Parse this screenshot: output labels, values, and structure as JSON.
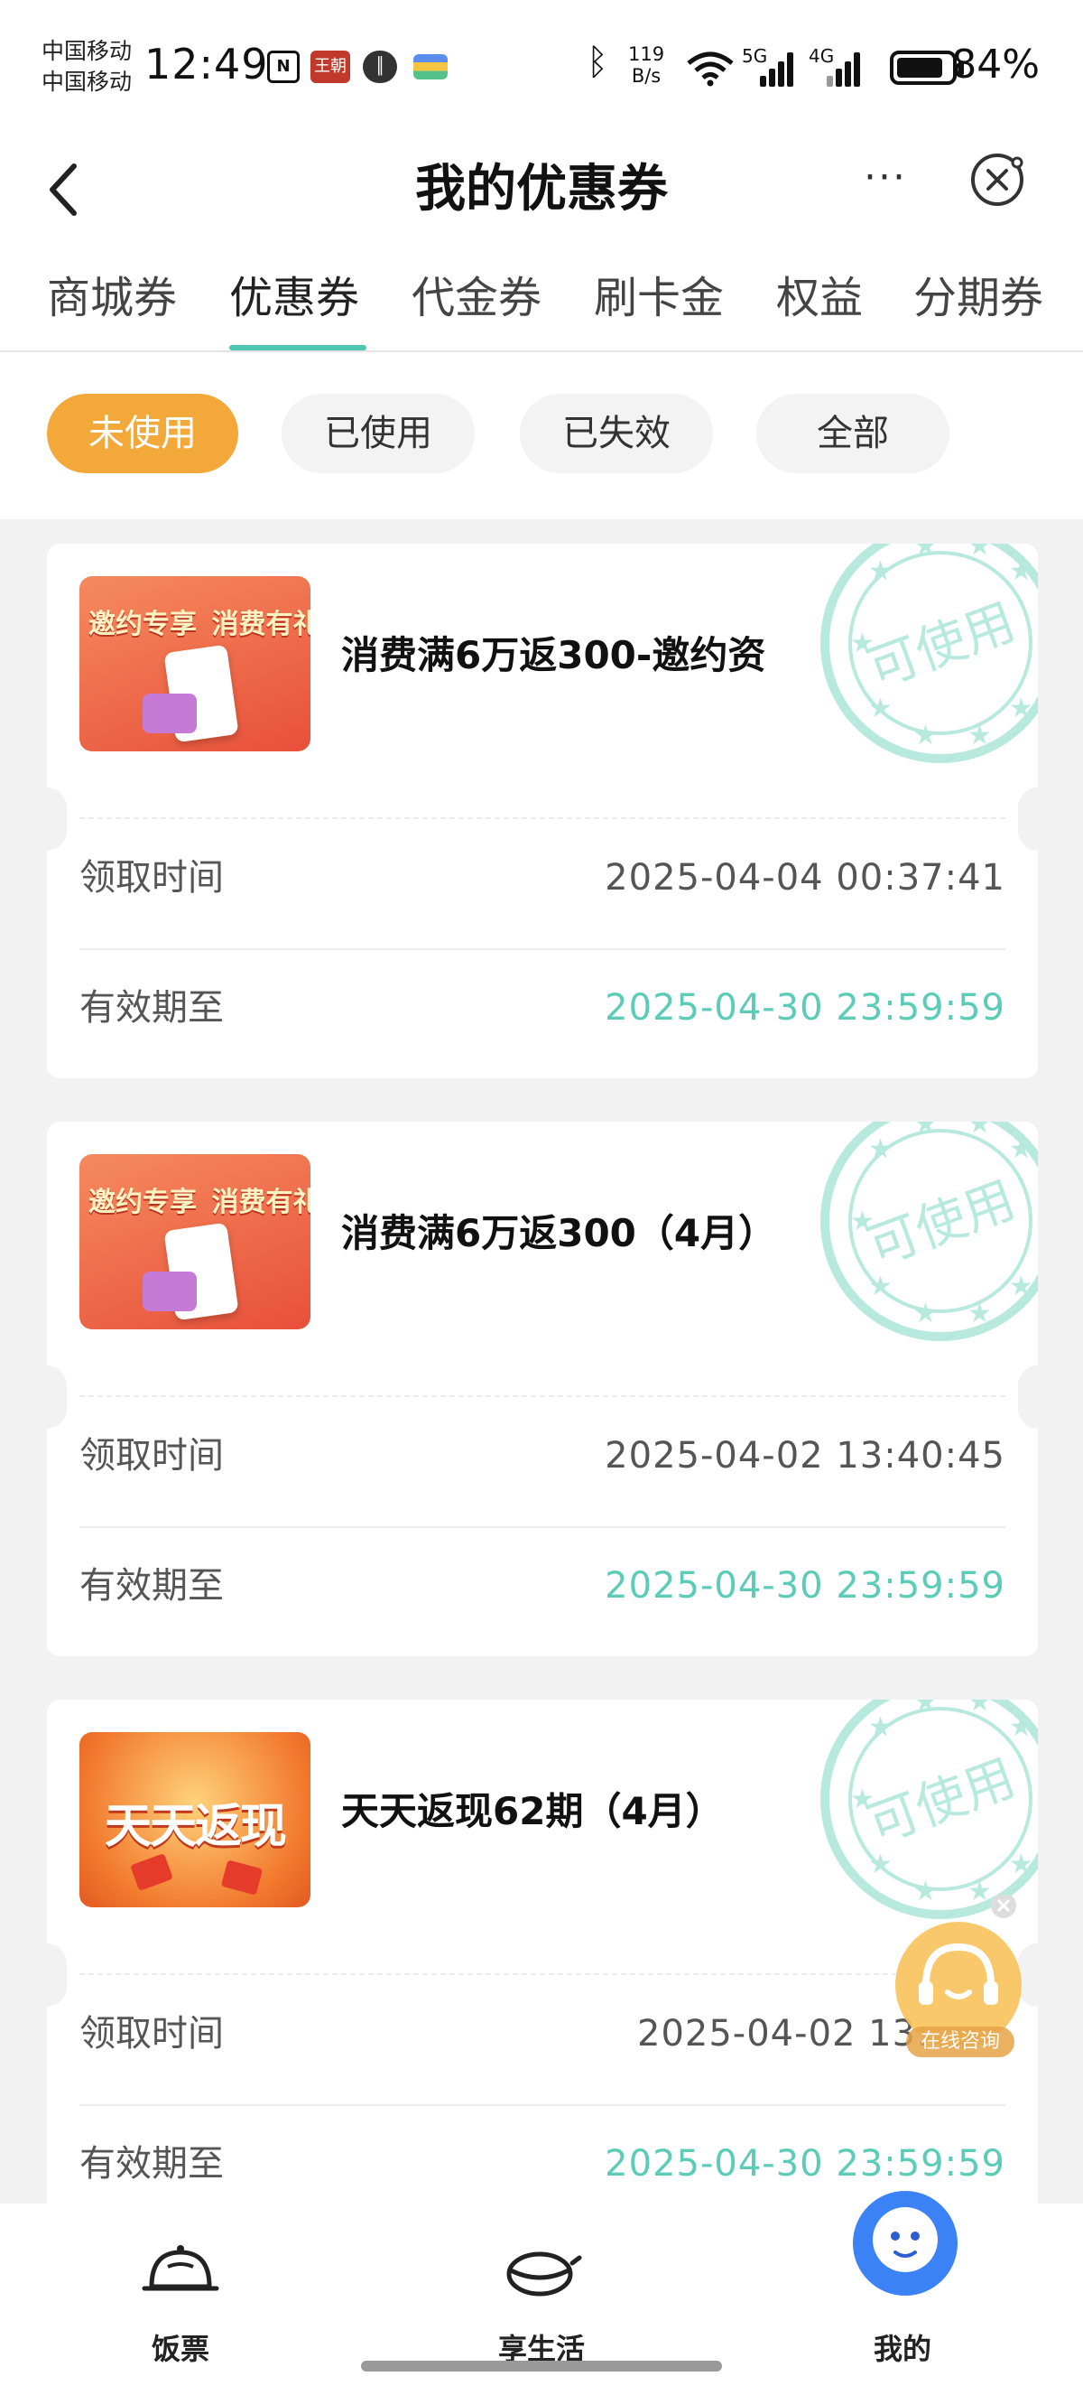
{
  "status_bar": {
    "carrier_1": "中国移动",
    "carrier_2": "中国移动",
    "time": "12:49",
    "app_badge": "王朝",
    "net_speed_top": "119",
    "net_speed_bottom": "B/s",
    "sig1_label": "5G",
    "sig2_label": "4G",
    "battery": "84%"
  },
  "header": {
    "title": "我的优惠券",
    "more_label": "···"
  },
  "tabs": [
    {
      "label": "商城券"
    },
    {
      "label": "优惠券"
    },
    {
      "label": "代金券"
    },
    {
      "label": "刷卡金"
    },
    {
      "label": "权益"
    },
    {
      "label": "分期券"
    }
  ],
  "active_tab": 1,
  "filters": [
    {
      "label": "未使用"
    },
    {
      "label": "已使用"
    },
    {
      "label": "已失效"
    },
    {
      "label": "全部"
    }
  ],
  "active_filter": 0,
  "coupons": [
    {
      "thumb_text_1": "邀约专享",
      "thumb_text_2": "消费有礼",
      "name": "消费满6万返300-邀约资",
      "received_label": "领取时间",
      "received": "2025-04-04 00:37:41",
      "valid_label": "有效期至",
      "valid": "2025-04-30 23:59:59",
      "stamp": "可使用"
    },
    {
      "thumb_text_1": "邀约专享",
      "thumb_text_2": "消费有礼",
      "name": "消费满6万返300（4月）",
      "received_label": "领取时间",
      "received": "2025-04-02 13:40:45",
      "valid_label": "有效期至",
      "valid": "2025-04-30 23:59:59",
      "stamp": "可使用"
    },
    {
      "thumb_text_1": "天天返现",
      "thumb_text_2": "",
      "name": "天天返现62期（4月）",
      "received_label": "领取时间",
      "received": "2025-04-02 13:",
      "valid_label": "有效期至",
      "valid": "2025-04-30 23:59:59",
      "stamp": "可使用"
    }
  ],
  "consult": {
    "label": "在线咨询"
  },
  "bottom_nav": [
    {
      "label": "饭票",
      "icon": "rice-bowl-icon"
    },
    {
      "label": "享生活",
      "icon": "bowl-icon"
    },
    {
      "label": "我的",
      "icon": "avatar-icon"
    }
  ],
  "colors": {
    "accent_teal": "#4ec7b2",
    "filter_active": "#f3a93a",
    "stamp": "#9fe0d3"
  }
}
